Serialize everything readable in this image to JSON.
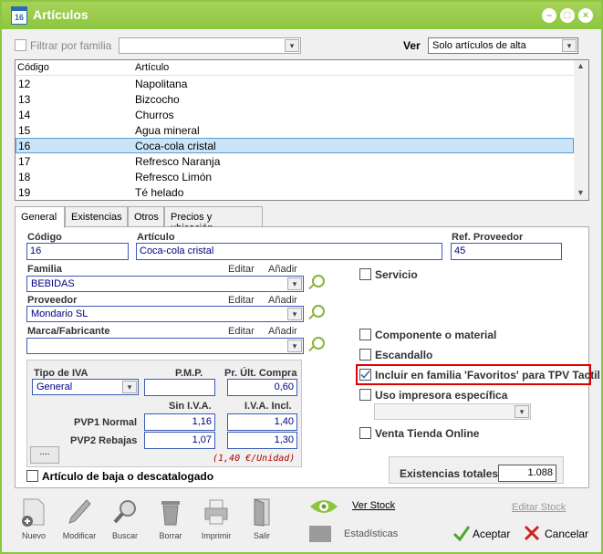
{
  "window": {
    "title": "Artículos",
    "icon_text": "16",
    "colors": {
      "titlebar": "#8cc63f",
      "selection": "#cce4f7",
      "highlight": "#e00000"
    }
  },
  "filter": {
    "label": "Filtrar por familia",
    "familia_value": "",
    "ver_label": "Ver",
    "ver_value": "Solo artículos de alta"
  },
  "list": {
    "headers": [
      "Código",
      "Artículo"
    ],
    "rows": [
      {
        "codigo": "12",
        "articulo": "Napolitana"
      },
      {
        "codigo": "13",
        "articulo": "Bizcocho"
      },
      {
        "codigo": "14",
        "articulo": "Churros"
      },
      {
        "codigo": "15",
        "articulo": "Agua mineral"
      },
      {
        "codigo": "16",
        "articulo": "Coca-cola cristal"
      },
      {
        "codigo": "17",
        "articulo": "Refresco Naranja"
      },
      {
        "codigo": "18",
        "articulo": "Refresco Limón"
      },
      {
        "codigo": "19",
        "articulo": "Té helado"
      }
    ],
    "selected_index": 4
  },
  "tabs": [
    "General",
    "Existencias",
    "Otros",
    "Precios y ubicación"
  ],
  "general": {
    "codigo_label": "Código",
    "codigo": "16",
    "articulo_label": "Artículo",
    "articulo": "Coca-cola cristal",
    "ref_label": "Ref. Proveedor",
    "ref": "45",
    "familia_label": "Familia",
    "familia": "BEBIDAS",
    "proveedor_label": "Proveedor",
    "proveedor": "Mondario SL",
    "marca_label": "Marca/Fabricante",
    "marca": "",
    "editar": "Editar",
    "anadir": "Añadir",
    "tipo_iva_label": "Tipo de IVA",
    "tipo_iva": "General",
    "pmp_label": "P.M.P.",
    "pmp": "",
    "pr_ult_label": "Pr. Últ. Compra",
    "pr_ult": "0,60",
    "sin_iva_label": "Sin I.V.A.",
    "iva_incl_label": "I.V.A. Incl.",
    "pvp1_label": "PVP1 Normal",
    "pvp1_sin": "1,16",
    "pvp1_con": "1,40",
    "pvp2_label": "PVP2 Rebajas",
    "pvp2_sin": "1,07",
    "pvp2_con": "1,30",
    "unidad_note": "(1,40 €/Unidad)",
    "more_button": "....",
    "baja_label": "Artículo de baja o descatalogado",
    "servicio": "Servicio",
    "componente": "Componente o material",
    "escandallo": "Escandallo",
    "favoritos": "Incluir en familia 'Favoritos' para TPV Tactil",
    "impresora": "Uso impresora específica",
    "venta_online": "Venta Tienda Online",
    "existencias_label": "Existencias totales",
    "existencias": "1.088"
  },
  "toolbar": {
    "nuevo": "Nuevo",
    "modificar": "Modificar",
    "buscar": "Buscar",
    "borrar": "Borrar",
    "imprimir": "Imprimir",
    "salir": "Salir",
    "ver_stock": "Ver Stock",
    "estadisticas": "Estadísticas",
    "editar_stock": "Editar Stock",
    "aceptar": "Aceptar",
    "cancelar": "Cancelar"
  }
}
